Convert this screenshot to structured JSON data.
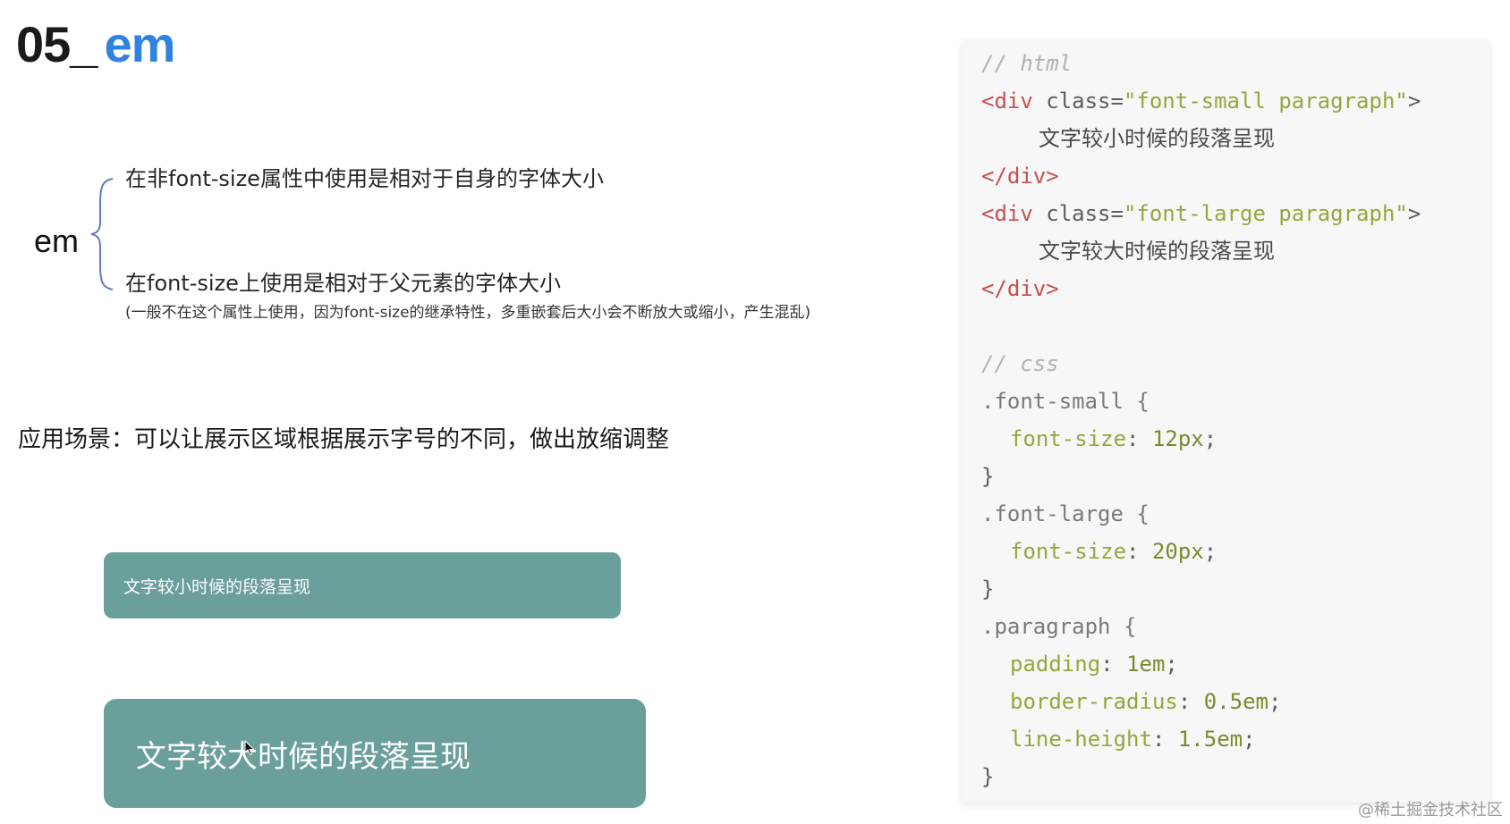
{
  "slide": {
    "number": "05",
    "separator": "_",
    "topic": "em"
  },
  "definition": {
    "term": "em",
    "line1": "在非font-size属性中使用是相对于自身的字体大小",
    "line2": "在font-size上使用是相对于父元素的字体大小",
    "note": "(一般不在这个属性上使用，因为font-size的继承特性，多重嵌套后大小会不断放大或缩小，产生混乱)"
  },
  "usage": "应用场景：可以让展示区域根据展示字号的不同，做出放缩调整",
  "demo": {
    "small_text": "文字较小时候的段落呈现",
    "large_text": "文字较大时候的段落呈现",
    "box_color": "#6a9f9b"
  },
  "code": {
    "html_comment": "// html",
    "small_open": {
      "tag_open": "<div",
      "attr": " class=",
      "value": "\"font-small paragraph\"",
      "close": ">"
    },
    "small_text": "文字较小时候的段落呈现",
    "close_div_1": "</div>",
    "large_open": {
      "tag_open": "<div",
      "attr": " class=",
      "value": "\"font-large paragraph\"",
      "close": ">"
    },
    "large_text": "文字较大时候的段落呈现",
    "close_div_2": "</div>",
    "css_comment": "// css",
    "rule_small": {
      "selector": ".font-small {",
      "prop": "font-size",
      "value": "12px"
    },
    "rule_large": {
      "selector": ".font-large {",
      "prop": "font-size",
      "value": "20px"
    },
    "rule_paragraph": {
      "selector": ".paragraph {",
      "padding_prop": "padding",
      "padding_value": "1em",
      "radius_prop": "border-radius",
      "radius_value": "0.5em",
      "lh_prop": "line-height",
      "lh_value": "1.5em"
    },
    "close_brace": "}",
    "colon": ": ",
    "semicolon": ";"
  },
  "watermark": "@稀土掘金技术社区",
  "icons": {
    "brace": "curly-brace-icon",
    "cursor": "mouse-cursor-icon"
  }
}
